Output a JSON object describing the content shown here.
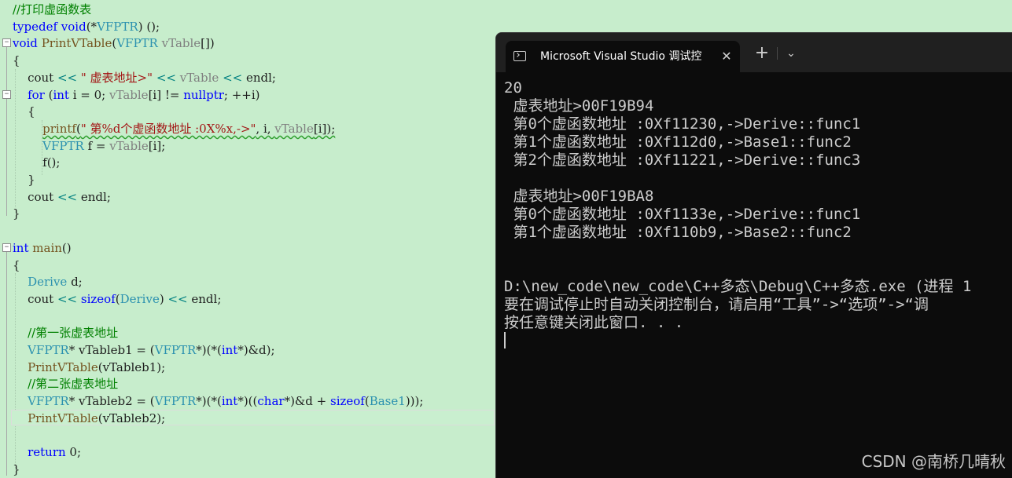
{
  "editor": {
    "lines": [
      [
        {
          "t": "//打印虚函数表",
          "c": "cm"
        }
      ],
      [
        {
          "t": "typedef",
          "c": "kw"
        },
        {
          "t": " ",
          "c": "pl"
        },
        {
          "t": "void",
          "c": "kw"
        },
        {
          "t": "(*",
          "c": "pl"
        },
        {
          "t": "VFPTR",
          "c": "ty"
        },
        {
          "t": ") ();",
          "c": "pl"
        }
      ],
      [
        {
          "t": "void",
          "c": "kw"
        },
        {
          "t": " ",
          "c": "pl"
        },
        {
          "t": "PrintVTable",
          "c": "fn"
        },
        {
          "t": "(",
          "c": "pl"
        },
        {
          "t": "VFPTR",
          "c": "ty"
        },
        {
          "t": " ",
          "c": "pl"
        },
        {
          "t": "vTable",
          "c": "pm"
        },
        {
          "t": "[])",
          "c": "pl"
        }
      ],
      [
        {
          "t": "{",
          "c": "pl"
        }
      ],
      [
        {
          "t": "    cout ",
          "c": "pl"
        },
        {
          "t": "<<",
          "c": "op"
        },
        {
          "t": " ",
          "c": "pl"
        },
        {
          "t": "\" 虚表地址>\"",
          "c": "st"
        },
        {
          "t": " ",
          "c": "pl"
        },
        {
          "t": "<<",
          "c": "op"
        },
        {
          "t": " ",
          "c": "pl"
        },
        {
          "t": "vTable",
          "c": "pm"
        },
        {
          "t": " ",
          "c": "pl"
        },
        {
          "t": "<<",
          "c": "op"
        },
        {
          "t": " endl;",
          "c": "pl"
        }
      ],
      [
        {
          "t": "    ",
          "c": "pl"
        },
        {
          "t": "for",
          "c": "kw"
        },
        {
          "t": " (",
          "c": "pl"
        },
        {
          "t": "int",
          "c": "kw"
        },
        {
          "t": " i = 0; ",
          "c": "pl"
        },
        {
          "t": "vTable",
          "c": "pm"
        },
        {
          "t": "[i] != ",
          "c": "pl"
        },
        {
          "t": "nullptr",
          "c": "kw"
        },
        {
          "t": "; ++i)",
          "c": "pl"
        }
      ],
      [
        {
          "t": "    {",
          "c": "pl"
        }
      ],
      [
        {
          "t": "        ",
          "c": "pl"
        },
        {
          "t": "printf",
          "c": "fn",
          "u": true
        },
        {
          "t": "(",
          "c": "pl",
          "u": true
        },
        {
          "t": "\" 第%d个虚函数地址 :0X%x,->\"",
          "c": "st",
          "u": true
        },
        {
          "t": ", i, ",
          "c": "pl",
          "u": true
        },
        {
          "t": "vTable",
          "c": "pm",
          "u": true
        },
        {
          "t": "[i]);",
          "c": "pl",
          "u": true
        }
      ],
      [
        {
          "t": "        ",
          "c": "pl"
        },
        {
          "t": "VFPTR",
          "c": "ty"
        },
        {
          "t": " f = ",
          "c": "pl"
        },
        {
          "t": "vTable",
          "c": "pm"
        },
        {
          "t": "[i];",
          "c": "pl"
        }
      ],
      [
        {
          "t": "        f();",
          "c": "pl"
        }
      ],
      [
        {
          "t": "    }",
          "c": "pl"
        }
      ],
      [
        {
          "t": "    cout ",
          "c": "pl"
        },
        {
          "t": "<<",
          "c": "op"
        },
        {
          "t": " endl;",
          "c": "pl"
        }
      ],
      [
        {
          "t": "}",
          "c": "pl"
        }
      ],
      [],
      [
        {
          "t": "int",
          "c": "kw"
        },
        {
          "t": " ",
          "c": "pl"
        },
        {
          "t": "main",
          "c": "fn"
        },
        {
          "t": "()",
          "c": "pl"
        }
      ],
      [
        {
          "t": "{",
          "c": "pl"
        }
      ],
      [
        {
          "t": "    ",
          "c": "pl"
        },
        {
          "t": "Derive",
          "c": "ty"
        },
        {
          "t": " d;",
          "c": "pl"
        }
      ],
      [
        {
          "t": "    cout ",
          "c": "pl"
        },
        {
          "t": "<<",
          "c": "op"
        },
        {
          "t": " ",
          "c": "pl"
        },
        {
          "t": "sizeof",
          "c": "kw"
        },
        {
          "t": "(",
          "c": "pl"
        },
        {
          "t": "Derive",
          "c": "ty"
        },
        {
          "t": ") ",
          "c": "pl"
        },
        {
          "t": "<<",
          "c": "op"
        },
        {
          "t": " endl;",
          "c": "pl"
        }
      ],
      [],
      [
        {
          "t": "    ",
          "c": "pl"
        },
        {
          "t": "//第一张虚表地址",
          "c": "cm"
        }
      ],
      [
        {
          "t": "    ",
          "c": "pl"
        },
        {
          "t": "VFPTR",
          "c": "ty"
        },
        {
          "t": "* vTableb1 = (",
          "c": "pl"
        },
        {
          "t": "VFPTR",
          "c": "ty"
        },
        {
          "t": "*)(*(",
          "c": "pl"
        },
        {
          "t": "int",
          "c": "kw"
        },
        {
          "t": "*)&d);",
          "c": "pl"
        }
      ],
      [
        {
          "t": "    ",
          "c": "pl"
        },
        {
          "t": "PrintVTable",
          "c": "fn"
        },
        {
          "t": "(vTableb1);",
          "c": "pl"
        }
      ],
      [
        {
          "t": "    ",
          "c": "pl"
        },
        {
          "t": "//第二张虚表地址",
          "c": "cm"
        }
      ],
      [
        {
          "t": "    ",
          "c": "pl"
        },
        {
          "t": "VFPTR",
          "c": "ty"
        },
        {
          "t": "* vTableb2 = (",
          "c": "pl"
        },
        {
          "t": "VFPTR",
          "c": "ty"
        },
        {
          "t": "*)(*(",
          "c": "pl"
        },
        {
          "t": "int",
          "c": "kw"
        },
        {
          "t": "*)((",
          "c": "pl"
        },
        {
          "t": "char",
          "c": "kw"
        },
        {
          "t": "*)&d + ",
          "c": "pl"
        },
        {
          "t": "sizeof",
          "c": "kw"
        },
        {
          "t": "(",
          "c": "pl"
        },
        {
          "t": "Base1",
          "c": "ty"
        },
        {
          "t": ")));",
          "c": "pl"
        }
      ],
      [
        {
          "t": "    ",
          "c": "pl"
        },
        {
          "t": "PrintVTable",
          "c": "fn"
        },
        {
          "t": "(vTableb2);",
          "c": "pl"
        }
      ],
      [],
      [
        {
          "t": "    ",
          "c": "pl"
        },
        {
          "t": "return",
          "c": "kw"
        },
        {
          "t": " 0;",
          "c": "pl"
        }
      ],
      [
        {
          "t": "}",
          "c": "pl"
        }
      ]
    ]
  },
  "console": {
    "tab_title": "Microsoft Visual Studio 调试控",
    "tab_close_glyph": "✕",
    "new_tab_glyph": "+",
    "dropdown_glyph": "⌄",
    "lines": [
      "20",
      " 虚表地址>00F19B94",
      " 第0个虚函数地址 :0Xf11230,->Derive::func1",
      " 第1个虚函数地址 :0Xf112d0,->Base1::func2",
      " 第2个虚函数地址 :0Xf11221,->Derive::func3",
      "",
      " 虚表地址>00F19BA8",
      " 第0个虚函数地址 :0Xf1133e,->Derive::func1",
      " 第1个虚函数地址 :0Xf110b9,->Base2::func2",
      "",
      "",
      "D:\\new_code\\new_code\\C++多态\\Debug\\C++多态.exe (进程 1",
      "要在调试停止时自动关闭控制台，请启用“工具”->“选项”->“调",
      "按任意键关闭此窗口. . ."
    ]
  },
  "watermark": "CSDN @南桥几晴秋",
  "colors": {
    "editor_bg": "#c7edcc",
    "keyword": "#0000ff",
    "type": "#2b91af",
    "comment": "#008000",
    "string": "#a31515",
    "function": "#74531f",
    "param": "#808080",
    "operator": "#008080",
    "console_bg": "#0c0c0c",
    "console_text": "#cccccc",
    "titlebar_bg": "#202020"
  }
}
